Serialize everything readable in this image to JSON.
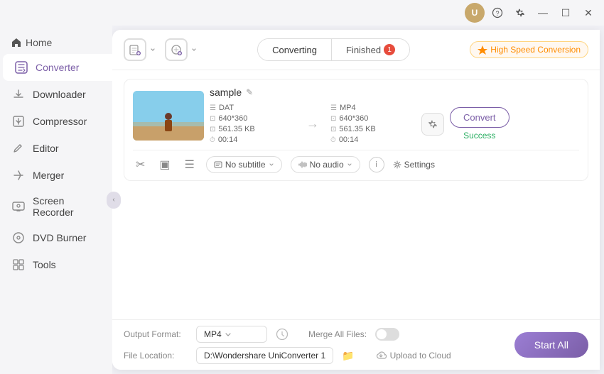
{
  "titleBar": {
    "userInitial": "U",
    "buttons": [
      "help",
      "settings",
      "minimize",
      "maximize",
      "close"
    ]
  },
  "sidebar": {
    "homeLabel": "Home",
    "items": [
      {
        "id": "converter",
        "label": "Converter",
        "active": true
      },
      {
        "id": "downloader",
        "label": "Downloader",
        "active": false
      },
      {
        "id": "compressor",
        "label": "Compressor",
        "active": false
      },
      {
        "id": "editor",
        "label": "Editor",
        "active": false
      },
      {
        "id": "merger",
        "label": "Merger",
        "active": false
      },
      {
        "id": "screen-recorder",
        "label": "Screen Recorder",
        "active": false
      },
      {
        "id": "dvd-burner",
        "label": "DVD Burner",
        "active": false
      },
      {
        "id": "tools",
        "label": "Tools",
        "active": false
      }
    ]
  },
  "header": {
    "tabs": [
      {
        "id": "converting",
        "label": "Converting",
        "active": true,
        "badge": null
      },
      {
        "id": "finished",
        "label": "Finished",
        "active": false,
        "badge": "1"
      }
    ],
    "highSpeedLabel": "High Speed Conversion"
  },
  "fileCard": {
    "fileName": "sample",
    "source": {
      "format": "DAT",
      "resolution": "640*360",
      "size": "561.35 KB",
      "duration": "00:14"
    },
    "target": {
      "format": "MP4",
      "resolution": "640*360",
      "size": "561.35 KB",
      "duration": "00:14"
    },
    "convertButtonLabel": "Convert",
    "statusLabel": "Success",
    "subtitleLabel": "No subtitle",
    "audioLabel": "No audio",
    "settingsLabel": "Settings"
  },
  "bottomBar": {
    "outputFormatLabel": "Output Format:",
    "outputFormatValue": "MP4",
    "fileLocationLabel": "File Location:",
    "fileLocationValue": "D:\\Wondershare UniConverter 1",
    "mergeAllFilesLabel": "Merge All Files:",
    "uploadToCloudLabel": "Upload to Cloud",
    "startAllLabel": "Start All"
  }
}
